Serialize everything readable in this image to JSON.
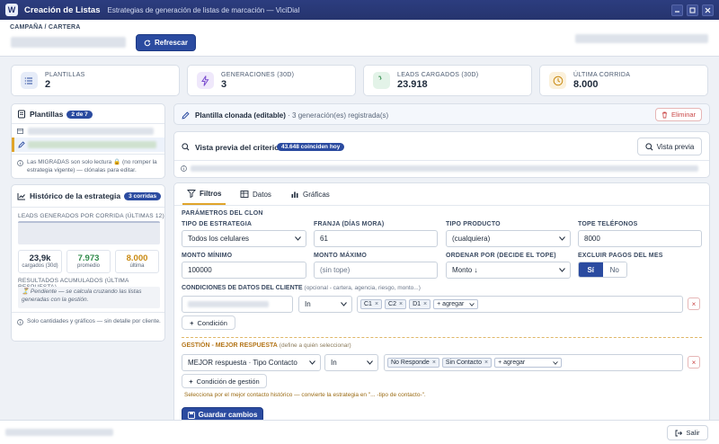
{
  "window": {
    "logo_letter": "W",
    "title": "Creación de Listas",
    "subtitle": "Estrategias de generación de listas de marcación — ViciDial"
  },
  "header": {
    "campaign_label": "CAMPAÑA / CARTERA",
    "refresh_label": "Refrescar"
  },
  "kpis": [
    {
      "label": "PLANTILLAS",
      "value": "2",
      "icon": "list-icon",
      "color": "#2b4ba0",
      "bg": "#e6ecf8"
    },
    {
      "label": "GENERACIONES (30D)",
      "value": "3",
      "icon": "bolt-icon",
      "color": "#7a4ccf",
      "bg": "#efe8fb"
    },
    {
      "label": "LEADS CARGADOS (30D)",
      "value": "23.918",
      "icon": "phone-icon",
      "color": "#2f8a4a",
      "bg": "#e3f3e8"
    },
    {
      "label": "ÚLTIMA CORRIDA",
      "value": "8.000",
      "icon": "clock-icon",
      "color": "#c98a12",
      "bg": "#fbf1dc"
    }
  ],
  "templates": {
    "title": "Plantillas",
    "count_badge": "2 de 7",
    "note": "Las MIGRADAS son solo lectura 🔒 (no romper la estrategia vigente) — clónalas para editar."
  },
  "history": {
    "title": "Histórico de la estrategia",
    "badge": "3 corridas",
    "chart_label": "LEADS GENERADOS POR CORRIDA (ÚLTIMAS 12)",
    "stats": [
      {
        "value": "23,9k",
        "label": "cargados (30d)",
        "color": "#1e2a3b"
      },
      {
        "value": "7.973",
        "label": "promedio",
        "color": "#2f8a4a"
      },
      {
        "value": "8.000",
        "label": "última",
        "color": "#c98a12"
      }
    ],
    "results_label": "RESULTADOS ACUMULADOS (ÚLTIMA RESPUESTA)",
    "pending_text": "⏳ Pendiente — se calcula cruzando las listas generadas con la gestión.",
    "footnote": "Solo cantidades y gráficos — sin detalle por cliente."
  },
  "clone_bar": {
    "title": "Plantilla clonada (editable)",
    "sub": " · 3 generación(es) registrada(s)",
    "delete_label": "Eliminar"
  },
  "preview": {
    "title": "Vista previa del criterio",
    "badge": "43.648 coinciden hoy",
    "button": "Vista previa"
  },
  "tabs": [
    {
      "label": "Filtros",
      "active": true
    },
    {
      "label": "Datos",
      "active": false
    },
    {
      "label": "Gráficas",
      "active": false
    }
  ],
  "params": {
    "heading": "PARÁMETROS DEL CLON",
    "tipo_estrategia_label": "TIPO DE ESTRATEGIA",
    "tipo_estrategia_value": "Todos los celulares",
    "franja_label": "FRANJA (DÍAS MORA)",
    "franja_value": "61",
    "tipo_producto_label": "TIPO PRODUCTO",
    "tipo_producto_value": "(cualquiera)",
    "tope_label": "TOPE TELÉFONOS",
    "tope_value": "8000",
    "monto_min_label": "MONTO MÍNIMO",
    "monto_min_value": "100000",
    "monto_max_label": "MONTO MÁXIMO",
    "monto_max_placeholder": "(sin tope)",
    "ordenar_label": "ORDENAR POR (DECIDE EL TOPE)",
    "ordenar_value": "Monto ↓",
    "excluir_label": "EXCLUIR PAGOS DEL MES",
    "excluir_si": "Sí",
    "excluir_no": "No"
  },
  "conditions": {
    "heading": "CONDICIONES DE DATOS DEL CLIENTE",
    "heading_note": "(opcional - cartera, agencia, riesgo, monto...)",
    "operator": "In",
    "chips": [
      "C1",
      "C2",
      "D1"
    ],
    "add_value_label": "+ agregar",
    "add_button": "Condición"
  },
  "gestion": {
    "heading": "GESTIÓN - MEJOR RESPUESTA",
    "heading_note": "(define a quién seleccionar)",
    "field_value": "MEJOR respuesta · Tipo Contacto",
    "operator": "In",
    "chips": [
      "No Responde",
      "Sin Contacto"
    ],
    "add_value_label": "+ agregar",
    "add_button": "Condición de gestión",
    "hint": "Selecciona por el mejor contacto histórico — convierte la estrategia en \"... -tipo de contacto-\"."
  },
  "save_label": "Guardar cambios",
  "exit_label": "Salir"
}
